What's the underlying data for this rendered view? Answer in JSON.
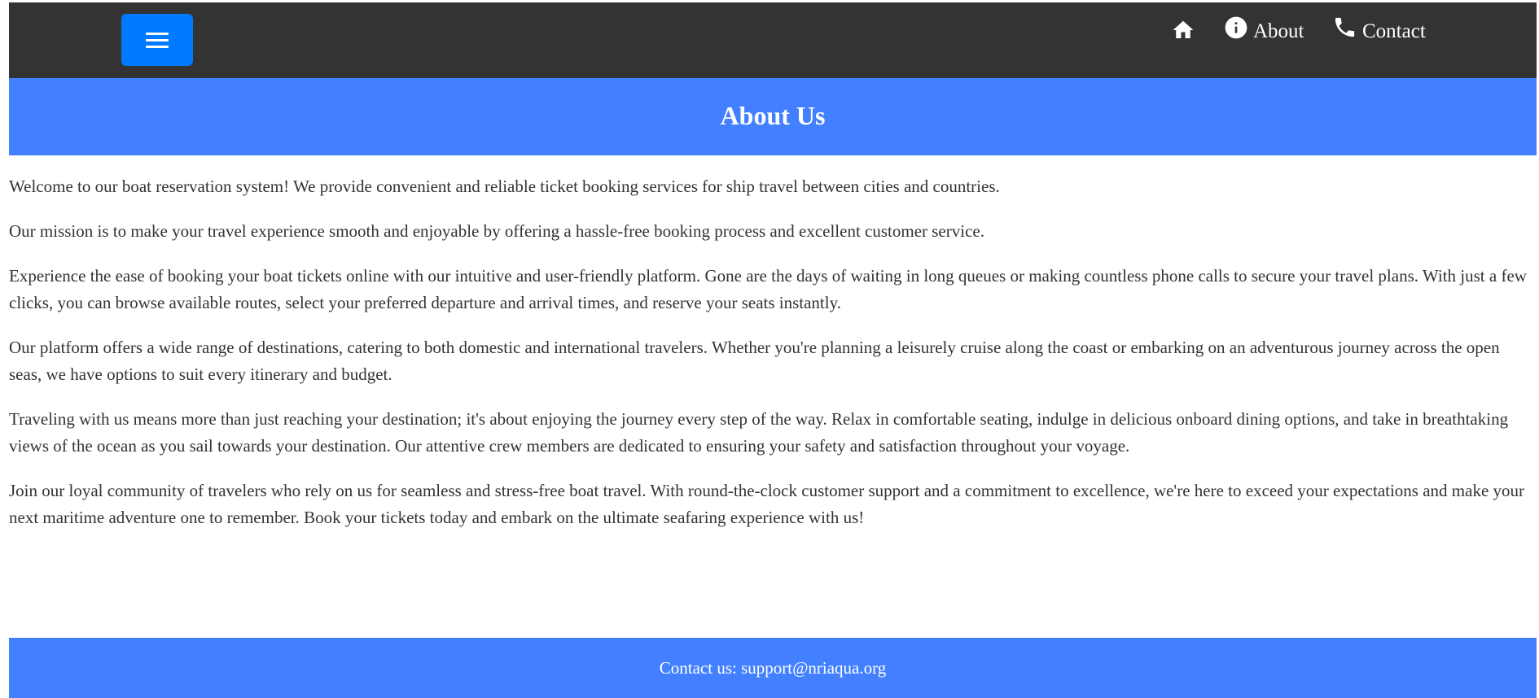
{
  "navbar": {
    "menu_icon": "hamburger-menu-icon",
    "links": [
      {
        "icon": "home-icon",
        "label": ""
      },
      {
        "icon": "info-icon",
        "label": "About"
      },
      {
        "icon": "phone-icon",
        "label": "Contact"
      }
    ],
    "background": "#333333",
    "menu_button_color": "#007bff"
  },
  "header": {
    "title": "About Us",
    "background": "#4380ff"
  },
  "content": {
    "paragraphs": [
      "Welcome to our boat reservation system! We provide convenient and reliable ticket booking services for ship travel between cities and countries.",
      "Our mission is to make your travel experience smooth and enjoyable by offering a hassle-free booking process and excellent customer service.",
      "Experience the ease of booking your boat tickets online with our intuitive and user-friendly platform. Gone are the days of waiting in long queues or making countless phone calls to secure your travel plans. With just a few clicks, you can browse available routes, select your preferred departure and arrival times, and reserve your seats instantly.",
      "Our platform offers a wide range of destinations, catering to both domestic and international travelers. Whether you're planning a leisurely cruise along the coast or embarking on an adventurous journey across the open seas, we have options to suit every itinerary and budget.",
      "Traveling with us means more than just reaching your destination; it's about enjoying the journey every step of the way. Relax in comfortable seating, indulge in delicious onboard dining options, and take in breathtaking views of the ocean as you sail towards your destination. Our attentive crew members are dedicated to ensuring your safety and satisfaction throughout your voyage.",
      "Join our loyal community of travelers who rely on us for seamless and stress-free boat travel. With round-the-clock customer support and a commitment to excellence, we're here to exceed your expectations and make your next maritime adventure one to remember. Book your tickets today and embark on the ultimate seafaring experience with us!"
    ]
  },
  "footer": {
    "text": "Contact us: support@nriaqua.org",
    "background": "#4380ff"
  }
}
